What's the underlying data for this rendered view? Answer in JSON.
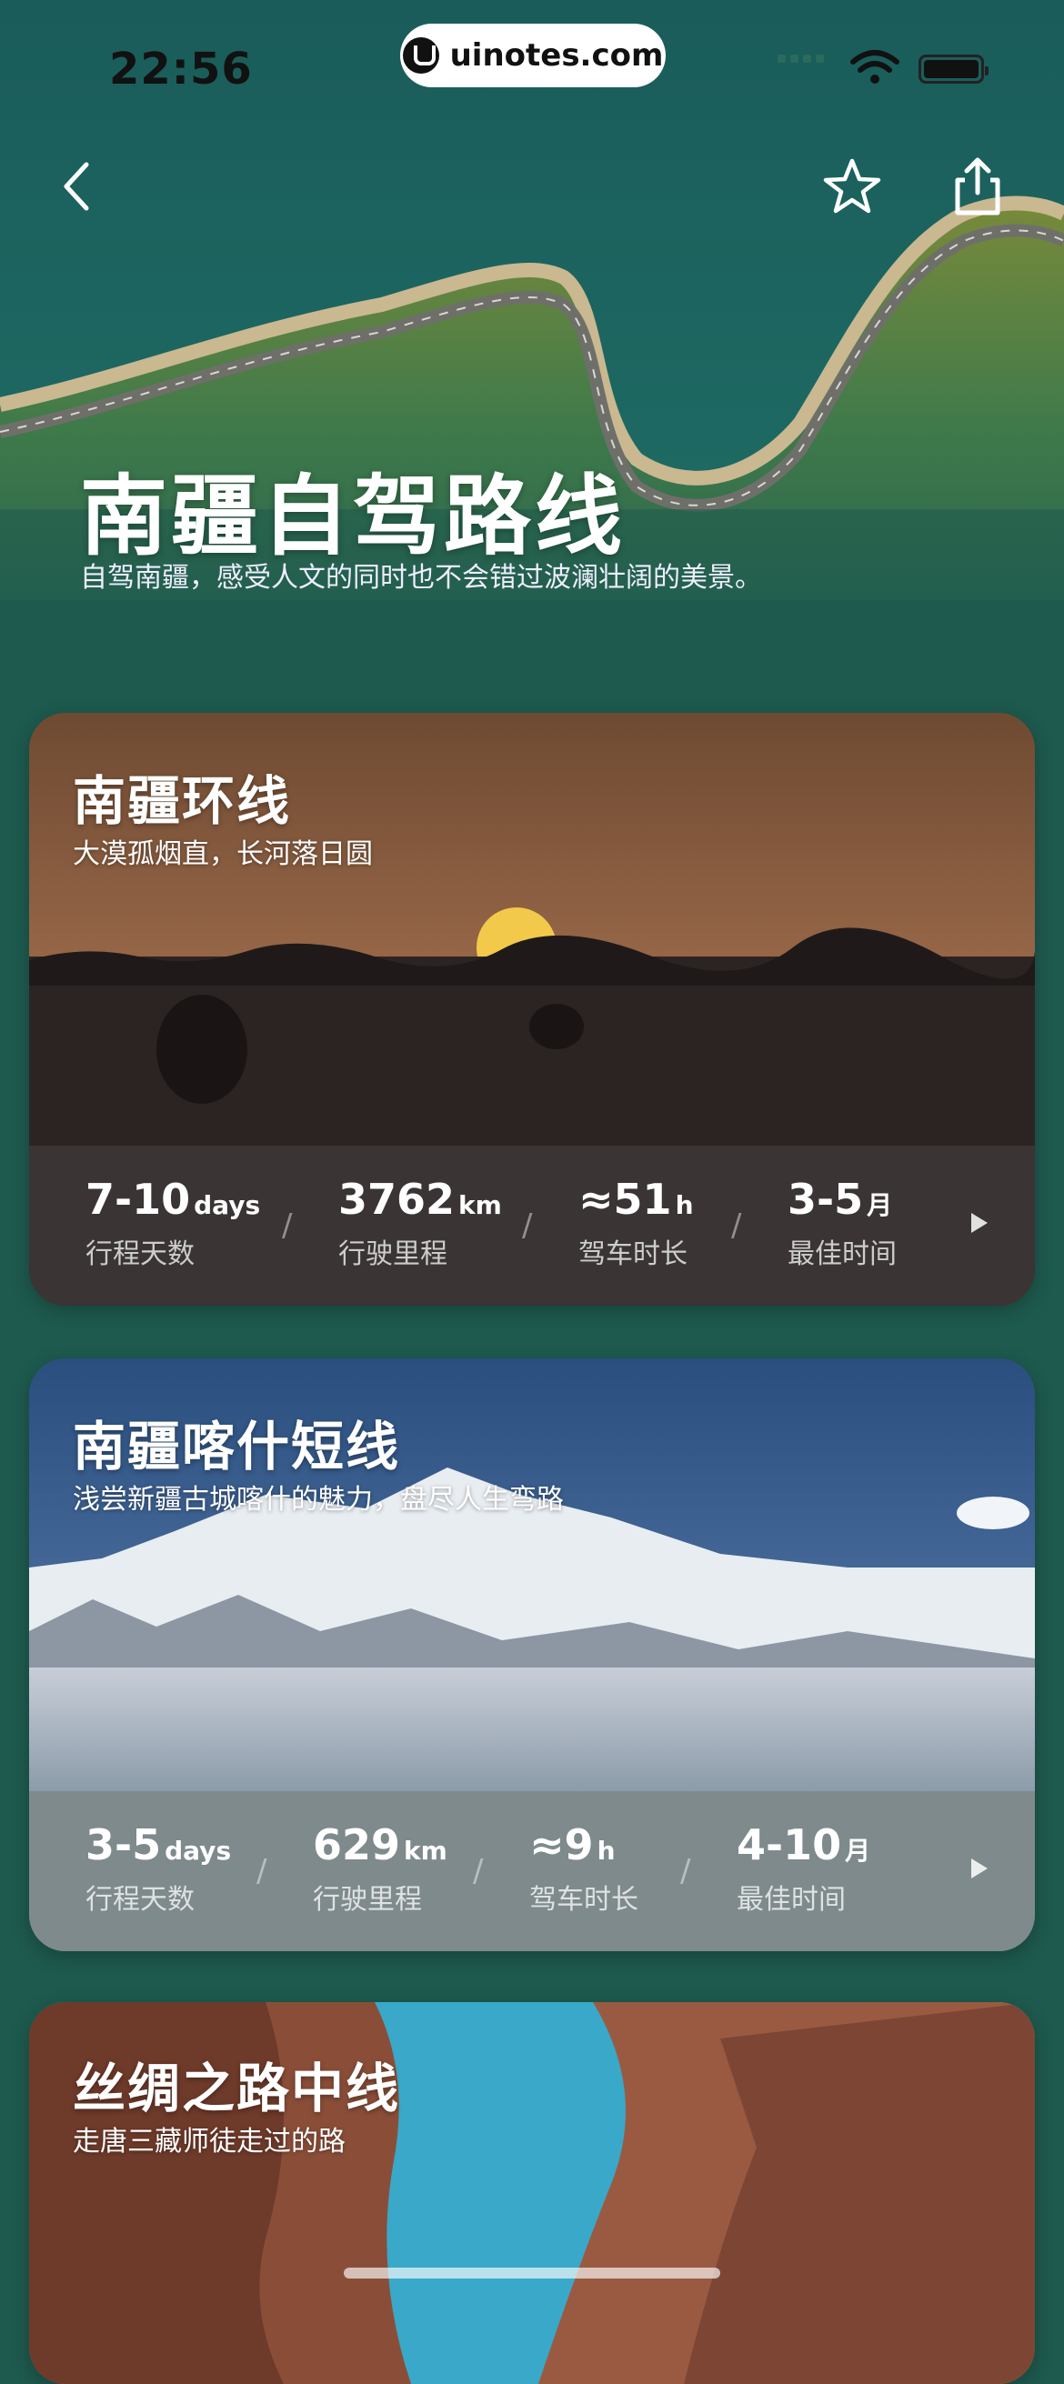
{
  "status_bar": {
    "time": "22:56",
    "site_label": "uinotes.com"
  },
  "header": {
    "back_icon": "chevron-left-icon",
    "favorite_icon": "star-outline-icon",
    "share_icon": "share-icon"
  },
  "hero": {
    "title": "南疆自驾路线",
    "subtitle": "自驾南疆，感受人文的同时也不会错过波澜壮阔的美景。"
  },
  "routes": [
    {
      "title": "南疆环线",
      "subtitle": "大漠孤烟直，长河落日圆",
      "stats": [
        {
          "value": "7-10",
          "unit": "days",
          "label": "行程天数"
        },
        {
          "value": "3762",
          "unit": "km",
          "label": "行驶里程"
        },
        {
          "value": "≈51",
          "unit": "h",
          "label": "驾车时长"
        },
        {
          "value": "3-5",
          "unit": "月",
          "label": "最佳时间"
        }
      ]
    },
    {
      "title": "南疆喀什短线",
      "subtitle": "浅尝新疆古城喀什的魅力，盘尽人生弯路",
      "stats": [
        {
          "value": "3-5",
          "unit": "days",
          "label": "行程天数"
        },
        {
          "value": "629",
          "unit": "km",
          "label": "行驶里程"
        },
        {
          "value": "≈9",
          "unit": "h",
          "label": "驾车时长"
        },
        {
          "value": "4-10",
          "unit": "月",
          "label": "最佳时间"
        }
      ]
    },
    {
      "title": "丝绸之路中线",
      "subtitle": "走唐三藏师徒走过的路"
    }
  ],
  "colors": {
    "page_bg": "#1e5a4e",
    "stats_bar_1": "#3a3434",
    "stats_bar_2": "#7e8a8c"
  }
}
